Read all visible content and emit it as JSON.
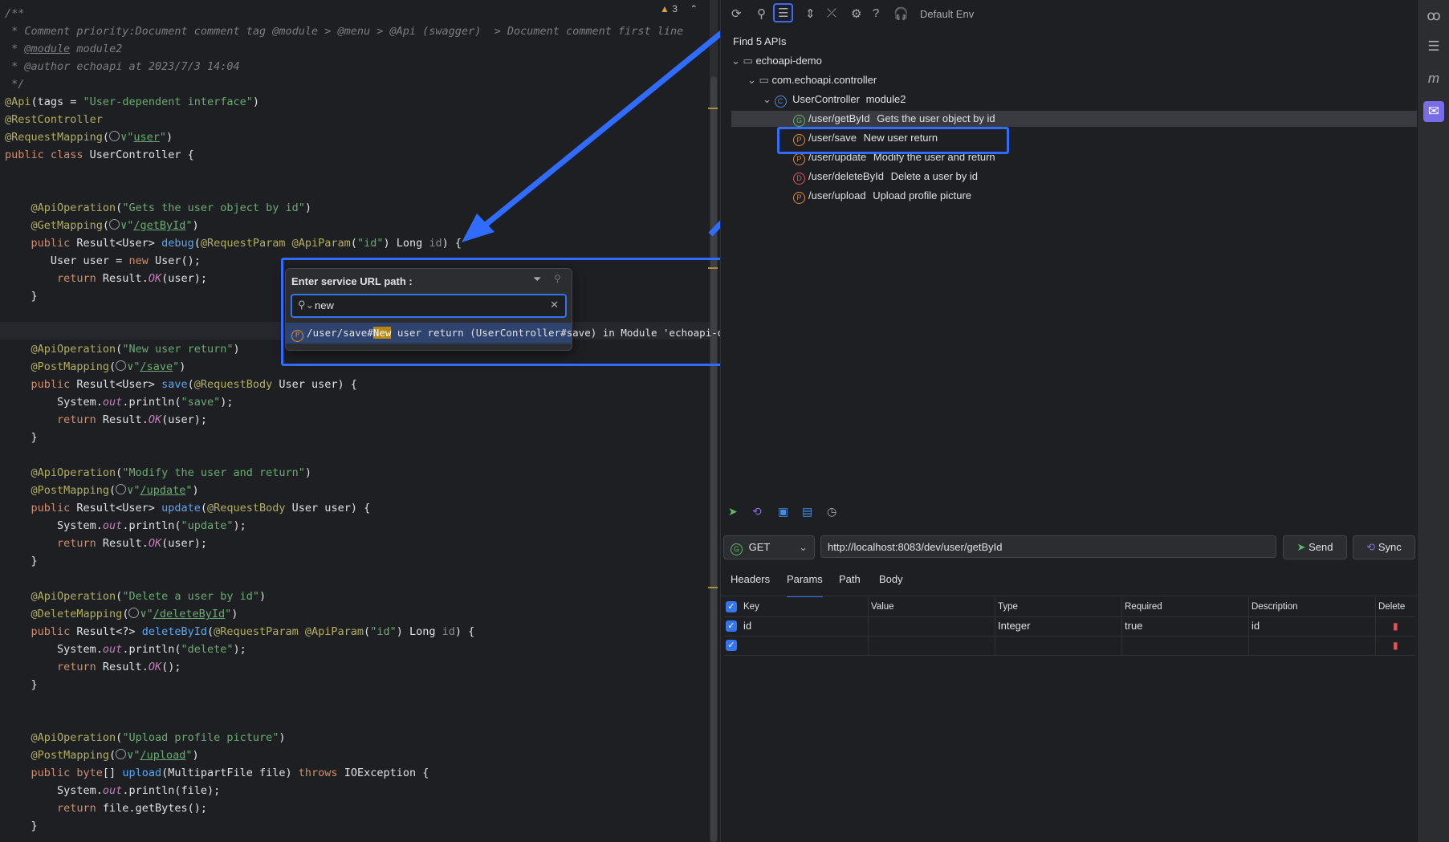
{
  "editor": {
    "warn_count": "3",
    "lines": [
      [
        [
          "cm",
          "/**"
        ]
      ],
      [
        [
          "cm",
          " * Comment priority:Document comment tag @module > @menu > @Api (swagger)  > Document comment first line"
        ]
      ],
      [
        [
          "cm",
          " * "
        ],
        [
          "cm ul",
          "@module"
        ],
        [
          "cm",
          " module2"
        ]
      ],
      [
        [
          "cm",
          " * "
        ],
        [
          "cm",
          "@author"
        ],
        [
          "cm",
          " echoapi at 2023/7/3 14:04"
        ]
      ],
      [
        [
          "cm",
          " */"
        ]
      ],
      [
        [
          "an",
          "@Api"
        ],
        [
          "",
          "(tags = "
        ],
        [
          "st",
          "\"User-dependent interface\""
        ],
        [
          "",
          ")"
        ]
      ],
      [
        [
          "an",
          "@RestController"
        ]
      ],
      [
        [
          "an",
          "@RequestMapping"
        ],
        [
          "",
          "("
        ],
        [
          "globe",
          ""
        ],
        [
          "st",
          "∨\""
        ],
        [
          "st ul",
          "user"
        ],
        [
          "st",
          "\""
        ],
        [
          "",
          ")"
        ]
      ],
      [
        [
          "kw",
          "public class "
        ],
        [
          "",
          "UserController {"
        ]
      ],
      [
        [
          "",
          ""
        ]
      ],
      [
        [
          "",
          ""
        ]
      ],
      [
        [
          "an",
          "    @ApiOperation"
        ],
        [
          "",
          "("
        ],
        [
          "st",
          "\"Gets the user object by id\""
        ],
        [
          "",
          ")"
        ]
      ],
      [
        [
          "an",
          "    @GetMapping"
        ],
        [
          "",
          "("
        ],
        [
          "globe",
          ""
        ],
        [
          "st",
          "∨\""
        ],
        [
          "st ul",
          "/getById"
        ],
        [
          "st",
          "\""
        ],
        [
          "",
          ")"
        ]
      ],
      [
        [
          "kw",
          "    public "
        ],
        [
          "",
          "Result<User> "
        ],
        [
          "fn",
          "debug"
        ],
        [
          "",
          "("
        ],
        [
          "an",
          "@RequestParam @ApiParam"
        ],
        [
          "",
          "("
        ],
        [
          "st",
          "\"id\""
        ],
        [
          "",
          ") Long "
        ],
        [
          "gr",
          "id"
        ],
        [
          "",
          ") {"
        ]
      ],
      [
        [
          "",
          "       User user = "
        ],
        [
          "kw",
          "new "
        ],
        [
          "",
          "User();"
        ]
      ],
      [
        [
          "kw",
          "        return "
        ],
        [
          "",
          "Result."
        ],
        [
          "it",
          "OK"
        ],
        [
          "",
          "(user);"
        ]
      ],
      [
        [
          "",
          "    }"
        ]
      ],
      [
        [
          "",
          ""
        ]
      ],
      [
        [
          "",
          ""
        ]
      ],
      [
        [
          "an",
          "    @ApiOperation"
        ],
        [
          "",
          "("
        ],
        [
          "st",
          "\"New user return\""
        ],
        [
          "",
          ")"
        ]
      ],
      [
        [
          "an",
          "    @PostMapping"
        ],
        [
          "",
          "("
        ],
        [
          "globe",
          ""
        ],
        [
          "st",
          "∨\""
        ],
        [
          "st ul",
          "/save"
        ],
        [
          "st",
          "\""
        ],
        [
          "",
          ")"
        ]
      ],
      [
        [
          "kw",
          "    public "
        ],
        [
          "",
          "Result<User> "
        ],
        [
          "fn",
          "save"
        ],
        [
          "",
          "("
        ],
        [
          "an",
          "@RequestBody "
        ],
        [
          "",
          "User user) {"
        ]
      ],
      [
        [
          "",
          "        System."
        ],
        [
          "it",
          "out"
        ],
        [
          "",
          ".println("
        ],
        [
          "st",
          "\"save\""
        ],
        [
          "",
          ");"
        ]
      ],
      [
        [
          "kw",
          "        return "
        ],
        [
          "",
          "Result."
        ],
        [
          "it",
          "OK"
        ],
        [
          "",
          "(user);"
        ]
      ],
      [
        [
          "",
          "    }"
        ]
      ],
      [
        [
          "",
          ""
        ]
      ],
      [
        [
          "an",
          "    @ApiOperation"
        ],
        [
          "",
          "("
        ],
        [
          "st",
          "\"Modify the user and return\""
        ],
        [
          "",
          ")"
        ]
      ],
      [
        [
          "an",
          "    @PostMapping"
        ],
        [
          "",
          "("
        ],
        [
          "globe",
          ""
        ],
        [
          "st",
          "∨\""
        ],
        [
          "st ul",
          "/update"
        ],
        [
          "st",
          "\""
        ],
        [
          "",
          ")"
        ]
      ],
      [
        [
          "kw",
          "    public "
        ],
        [
          "",
          "Result<User> "
        ],
        [
          "fn",
          "update"
        ],
        [
          "",
          "("
        ],
        [
          "an",
          "@RequestBody "
        ],
        [
          "",
          "User user) {"
        ]
      ],
      [
        [
          "",
          "        System."
        ],
        [
          "it",
          "out"
        ],
        [
          "",
          ".println("
        ],
        [
          "st",
          "\"update\""
        ],
        [
          "",
          ");"
        ]
      ],
      [
        [
          "kw",
          "        return "
        ],
        [
          "",
          "Result."
        ],
        [
          "it",
          "OK"
        ],
        [
          "",
          "(user);"
        ]
      ],
      [
        [
          "",
          "    }"
        ]
      ],
      [
        [
          "",
          ""
        ]
      ],
      [
        [
          "an",
          "    @ApiOperation"
        ],
        [
          "",
          "("
        ],
        [
          "st",
          "\"Delete a user by id\""
        ],
        [
          "",
          ")"
        ]
      ],
      [
        [
          "an",
          "    @DeleteMapping"
        ],
        [
          "",
          "("
        ],
        [
          "globe",
          ""
        ],
        [
          "st",
          "∨\""
        ],
        [
          "st ul",
          "/deleteById"
        ],
        [
          "st",
          "\""
        ],
        [
          "",
          ")"
        ]
      ],
      [
        [
          "kw",
          "    public "
        ],
        [
          "",
          "Result<?> "
        ],
        [
          "fn",
          "deleteById"
        ],
        [
          "",
          "("
        ],
        [
          "an",
          "@RequestParam @ApiParam"
        ],
        [
          "",
          "("
        ],
        [
          "st",
          "\"id\""
        ],
        [
          "",
          ") Long "
        ],
        [
          "gr",
          "id"
        ],
        [
          "",
          ") {"
        ]
      ],
      [
        [
          "",
          "        System."
        ],
        [
          "it",
          "out"
        ],
        [
          "",
          ".println("
        ],
        [
          "st",
          "\"delete\""
        ],
        [
          "",
          ");"
        ]
      ],
      [
        [
          "kw",
          "        return "
        ],
        [
          "",
          "Result."
        ],
        [
          "it",
          "OK"
        ],
        [
          "",
          "();"
        ]
      ],
      [
        [
          "",
          "    }"
        ]
      ],
      [
        [
          "",
          ""
        ]
      ],
      [
        [
          "",
          ""
        ]
      ],
      [
        [
          "an",
          "    @ApiOperation"
        ],
        [
          "",
          "("
        ],
        [
          "st",
          "\"Upload profile picture\""
        ],
        [
          "",
          ")"
        ]
      ],
      [
        [
          "an",
          "    @PostMapping"
        ],
        [
          "",
          "("
        ],
        [
          "globe",
          ""
        ],
        [
          "st",
          "∨\""
        ],
        [
          "st ul",
          "/upload"
        ],
        [
          "st",
          "\""
        ],
        [
          "",
          ")"
        ]
      ],
      [
        [
          "kw",
          "    public "
        ],
        [
          "kw",
          "byte"
        ],
        [
          "",
          "[] "
        ],
        [
          "fn",
          "upload"
        ],
        [
          "",
          "(MultipartFile file) "
        ],
        [
          "kw",
          "throws "
        ],
        [
          "",
          "IOException {"
        ]
      ],
      [
        [
          "",
          "        System."
        ],
        [
          "it",
          "out"
        ],
        [
          "",
          ".println(file);"
        ]
      ],
      [
        [
          "kw",
          "        return "
        ],
        [
          "",
          "file.getBytes();"
        ]
      ],
      [
        [
          "",
          "    }"
        ]
      ]
    ]
  },
  "search_popup": {
    "title": "Enter service URL path :",
    "query": "new",
    "result_badge": "P",
    "result_path": "/user/save#",
    "result_match": "New",
    "result_rest": " user return (UserController#save) in Module 'echoapi-demo'"
  },
  "panel": {
    "env": "Default Env",
    "find_label": "Find 5 APIs",
    "project": "echoapi-demo",
    "package": "com.echoapi.controller",
    "controller": "UserController",
    "controller_module": "module2",
    "apis": [
      {
        "badge": "G",
        "path": "/user/getById",
        "desc": "Gets the user object by id"
      },
      {
        "badge": "P",
        "path": "/user/save",
        "desc": "New user return"
      },
      {
        "badge": "P",
        "path": "/user/update",
        "desc": "Modify the user and return"
      },
      {
        "badge": "D",
        "path": "/user/deleteById",
        "desc": "Delete a user by id"
      },
      {
        "badge": "P",
        "path": "/user/upload",
        "desc": "Upload profile picture"
      }
    ]
  },
  "request": {
    "method_badge": "G",
    "method": "GET",
    "url": "http://localhost:8083/dev/user/getById",
    "send": "Send",
    "sync": "Sync",
    "tabs": [
      "Headers",
      "Params",
      "Path",
      "Body"
    ],
    "active_tab": "Params",
    "columns": [
      "Key",
      "Value",
      "Type",
      "Required",
      "Description",
      "Delete"
    ],
    "rows": [
      {
        "key": "id",
        "value": "",
        "type": "Integer",
        "required": "true",
        "description": "id"
      },
      {
        "key": "",
        "value": "",
        "type": "",
        "required": "",
        "description": ""
      }
    ]
  }
}
